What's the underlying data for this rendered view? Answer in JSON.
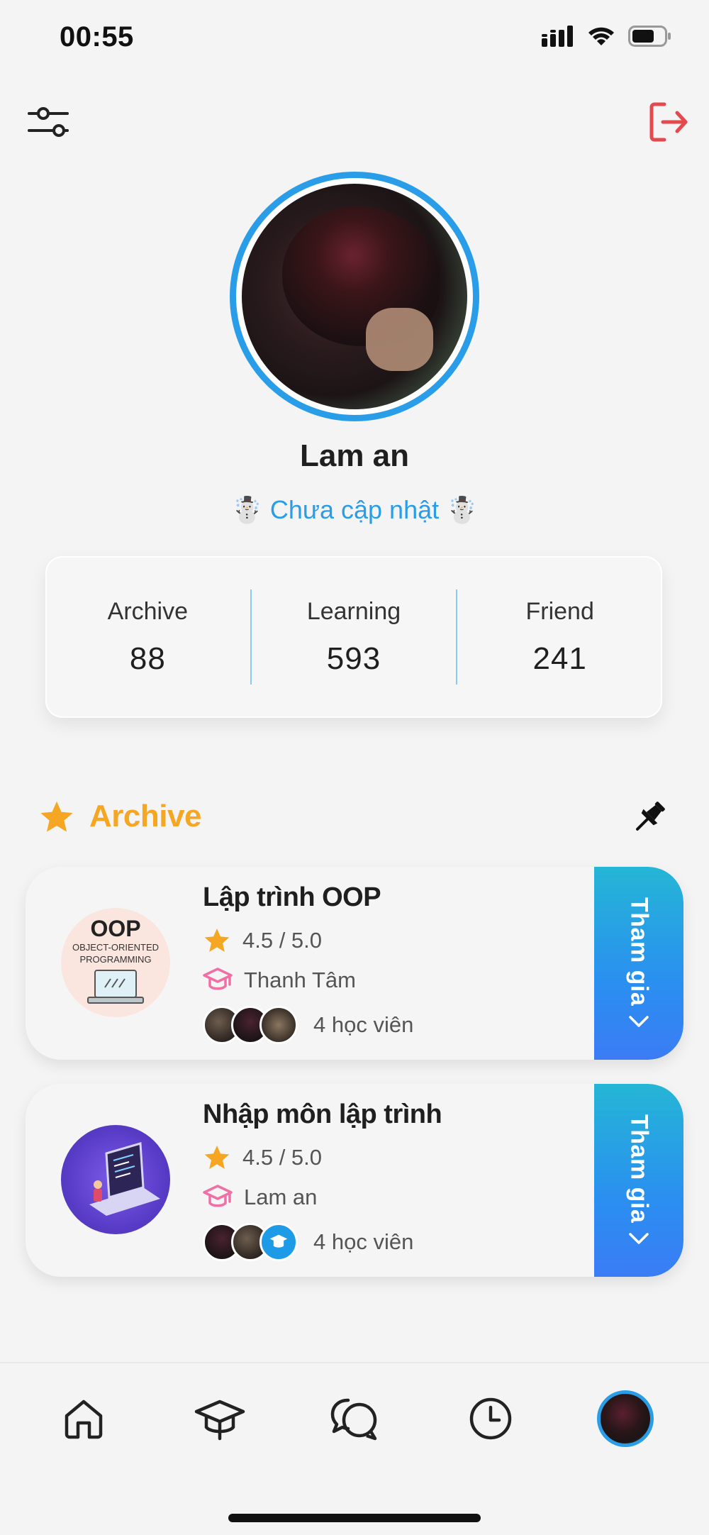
{
  "status_bar": {
    "time": "00:55"
  },
  "profile": {
    "name": "Lam an",
    "status": "☃️ Chưa cập nhật ☃️"
  },
  "stats": [
    {
      "label": "Archive",
      "value": "88"
    },
    {
      "label": "Learning",
      "value": "593"
    },
    {
      "label": "Friend",
      "value": "241"
    }
  ],
  "archive": {
    "title": "Archive",
    "courses": [
      {
        "title": "Lập trình OOP",
        "rating": "4.5 / 5.0",
        "teacher": "Thanh Tâm",
        "students": "4 học viên",
        "join_label": "Tham gia",
        "thumb_text_main": "OOP",
        "thumb_text_sub1": "OBJECT-ORIENTED",
        "thumb_text_sub2": "PROGRAMMING"
      },
      {
        "title": "Nhập môn lập trình",
        "rating": "4.5 / 5.0",
        "teacher": "Lam an",
        "students": "4 học viên",
        "join_label": "Tham gia"
      }
    ]
  },
  "colors": {
    "accent_blue": "#2a9de8",
    "archive_orange": "#f5a623",
    "logout_red": "#e5484d",
    "teacher_pink": "#f06fa4"
  },
  "icons": {
    "filter": "sliders-icon",
    "logout": "logout-icon",
    "pin": "pin-icon",
    "nav": [
      "home-icon",
      "graduation-cap-icon",
      "chat-icon",
      "clock-icon",
      "profile-avatar"
    ]
  }
}
